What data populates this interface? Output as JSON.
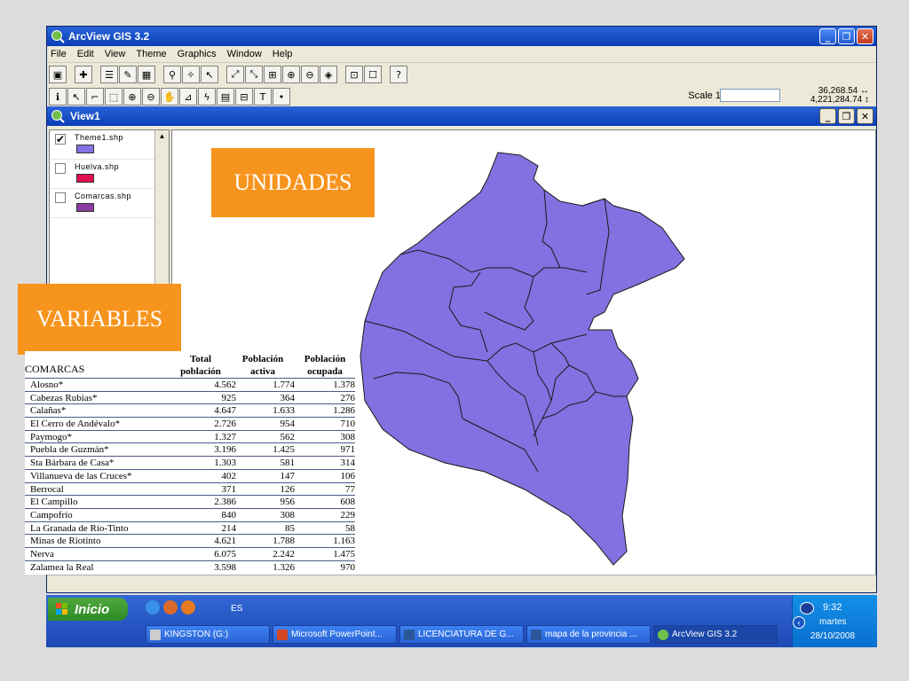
{
  "app": {
    "title": "ArcView GIS 3.2",
    "menus": [
      "File",
      "Edit",
      "View",
      "Theme",
      "Graphics",
      "Window",
      "Help"
    ],
    "scale_label": "Scale 1:",
    "scale_value": "",
    "coord_x": "36,268.54 ↔",
    "coord_y": "4,221,284.74 ↕"
  },
  "view": {
    "title": "View1",
    "themes": [
      {
        "name": "Theme1.shp",
        "checked": true,
        "color": "#8470e0"
      },
      {
        "name": "Huelva.shp",
        "checked": false,
        "color": "#e0104e"
      },
      {
        "name": "Comarcas.shp",
        "checked": false,
        "color": "#8a3fa0"
      }
    ]
  },
  "map": {
    "fill": "#8470e0",
    "stroke": "#1a1a1a"
  },
  "labels": {
    "unidades": "UNIDADES",
    "variables": "VARIABLES"
  },
  "table": {
    "row_header": "COMARCAS",
    "headers": [
      "Total población",
      "Población activa",
      "Población ocupada"
    ],
    "rows": [
      [
        "Alosno*",
        "4.562",
        "1.774",
        "1.378"
      ],
      [
        "Cabezas Rubias*",
        "925",
        "364",
        "276"
      ],
      [
        "Calañas*",
        "4.647",
        "1.633",
        "1.286"
      ],
      [
        "El Cerro de Andévalo*",
        "2.726",
        "954",
        "710"
      ],
      [
        "Paymogo*",
        "1.327",
        "562",
        "308"
      ],
      [
        "Puebla de Guzmán*",
        "3.196",
        "1.425",
        "971"
      ],
      [
        "Sta Bárbara de Casa*",
        "1.303",
        "581",
        "314"
      ],
      [
        "Villanueva de las Cruces*",
        "402",
        "147",
        "106"
      ],
      [
        "Berrocal",
        "371",
        "126",
        "77"
      ],
      [
        "El Campillo",
        "2.386",
        "956",
        "608"
      ],
      [
        "Campofrío",
        "840",
        "308",
        "229"
      ],
      [
        "La Granada de Río-Tinto",
        "214",
        "85",
        "58"
      ],
      [
        "Minas de Riotinto",
        "4.621",
        "1.788",
        "1.163"
      ],
      [
        "Nerva",
        "6.075",
        "2.242",
        "1.475"
      ],
      [
        "Zalamea la Real",
        "3.598",
        "1.326",
        "970"
      ]
    ]
  },
  "taskbar": {
    "start_label": "Inicio",
    "lang": "ES",
    "tasks": [
      "KINGSTON (G:)",
      "Microsoft PowerPoint...",
      "LICENCIATURA DE G...",
      "mapa de la provincia ...",
      "ArcView GIS 3.2"
    ],
    "time": "9:32",
    "day": "martes",
    "date": "28/10/2008"
  }
}
